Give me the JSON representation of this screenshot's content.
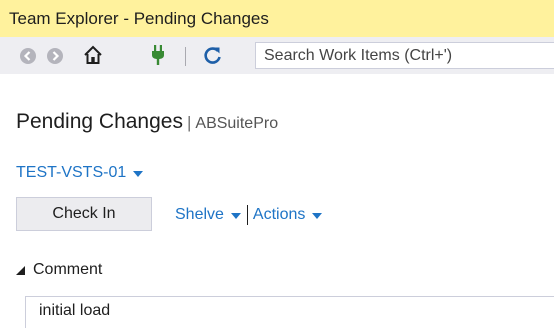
{
  "window": {
    "title": "Team Explorer - Pending Changes"
  },
  "toolbar": {
    "back_icon": "back-arrow-circle",
    "forward_icon": "forward-arrow-circle",
    "home_icon": "home",
    "connect_icon": "plug",
    "refresh_icon": "refresh",
    "search_placeholder": "Search Work Items (Ctrl+')"
  },
  "page": {
    "title": "Pending Changes",
    "separator": "|",
    "project": "ABSuitePro"
  },
  "workspace": {
    "name": "TEST-VSTS-01"
  },
  "actions": {
    "check_in_label": "Check In",
    "shelve_label": "Shelve",
    "divider": "|",
    "actions_label": "Actions"
  },
  "comment_section": {
    "header": "Comment",
    "value": "initial load"
  },
  "colors": {
    "title_bar": "#fff29d",
    "toolbar": "#eeeef2",
    "link": "#1e74c6"
  }
}
